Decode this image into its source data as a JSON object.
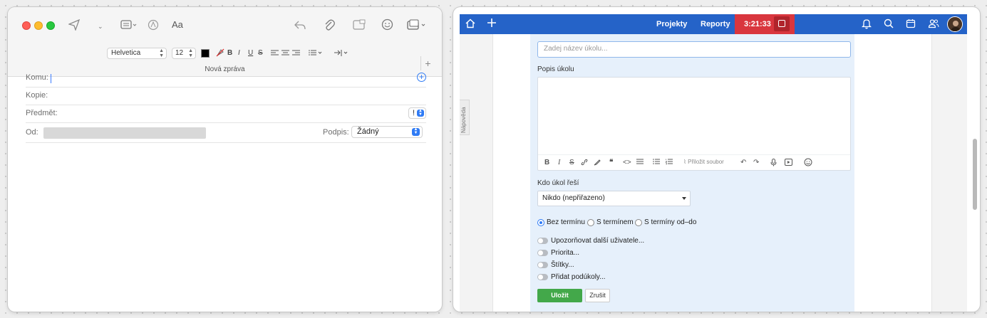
{
  "mail": {
    "window_title": "Nová zpráva",
    "toolbar": {
      "font_name": "Helvetica",
      "font_size": "12",
      "aa_label": "Aa",
      "bold": "B",
      "italic": "I",
      "underline": "U",
      "strike": "S",
      "plus": "+"
    },
    "fields": {
      "to_label": "Komu:",
      "cc_label": "Kopie:",
      "subject_label": "Předmět:",
      "from_label": "Od:",
      "priority": "!",
      "signature_label": "Podpis:",
      "signature_value": "Žádný"
    }
  },
  "app": {
    "header": {
      "projects": "Projekty",
      "reports": "Reporty",
      "timer": "3:21:33"
    },
    "help_tab": "Nápověda",
    "form": {
      "task_name_placeholder": "Zadej název úkolu...",
      "description_label": "Popis úkolu",
      "attach_label": "Přiložit soubor",
      "assignee_label": "Kdo úkol řeší",
      "assignee_value": "Nikdo (nepřiřazeno)",
      "deadline_options": [
        "Bez termínu",
        "S termínem",
        "S termíny od–do"
      ],
      "deadline_selected": "Bez termínu",
      "toggles": [
        "Upozorňovat další uživatele...",
        "Priorita...",
        "Štítky...",
        "Přidat podúkoly..."
      ],
      "save_label": "Uložit",
      "cancel_label": "Zrušit"
    }
  },
  "colors": {
    "header_blue": "#2563c8",
    "timer_red": "#d9363e",
    "save_green": "#43a84a",
    "form_bg": "#e6f0fb"
  }
}
